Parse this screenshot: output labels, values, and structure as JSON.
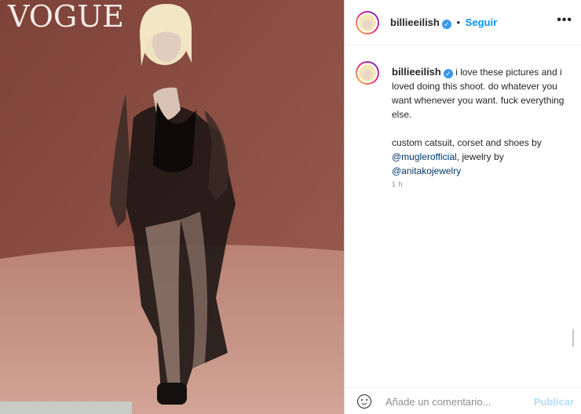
{
  "photo": {
    "magazine_logo": "VOGUE",
    "alt": "post photo"
  },
  "header": {
    "username": "billieeilish",
    "separator": "•",
    "follow_label": "Seguir",
    "more_icon": "more-options-icon"
  },
  "caption": {
    "username": "billieeilish",
    "line1": "i love these pictures and i loved doing this shoot. do whatever you want whenever you want. fuck everything else.",
    "line2_prefix": "custom catsuit, corset and shoes by ",
    "mention1": "@muglerofficial",
    "line2_mid": ", jewelry by ",
    "mention2": "@anitakojewelry",
    "time": "1 h"
  },
  "comment": {
    "placeholder": "Añade un comentario...",
    "publish_label": "Publicar",
    "emoji_icon": "emoji-icon"
  },
  "colors": {
    "verified": "#3897f0",
    "link": "#0095f6",
    "background_photo": "#8a4e44"
  }
}
